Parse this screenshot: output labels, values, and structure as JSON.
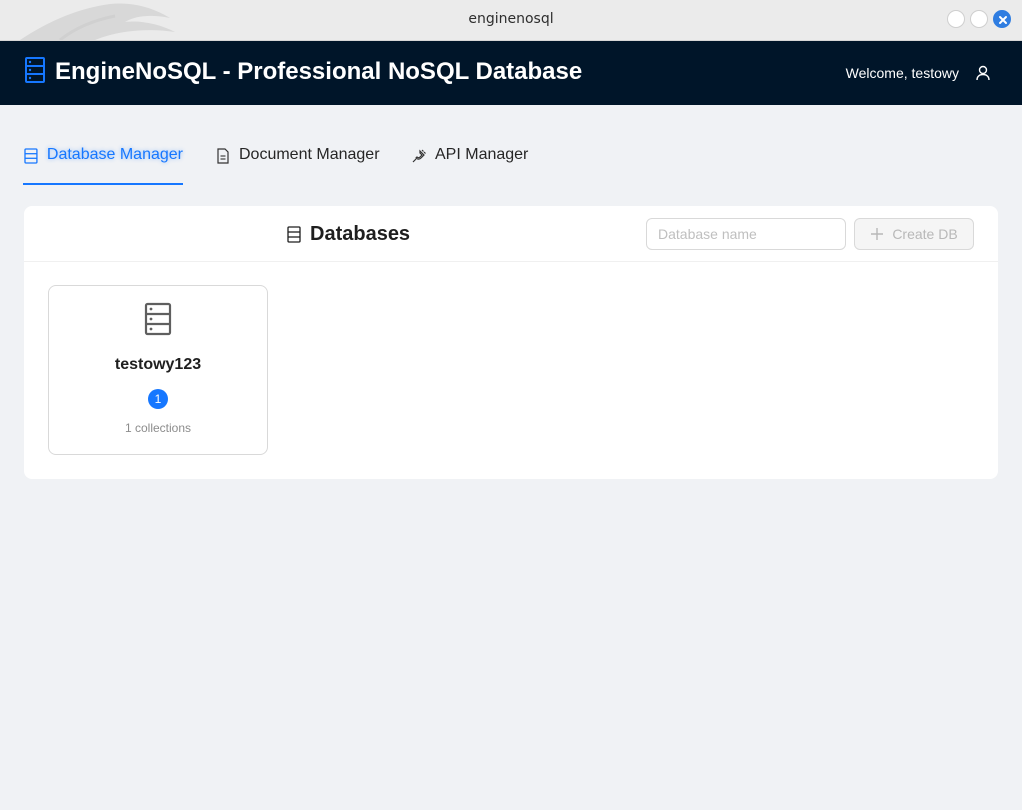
{
  "window": {
    "title": "enginenosql"
  },
  "header": {
    "app_title": "EngineNoSQL - Professional NoSQL Database",
    "welcome_text": "Welcome, testowy",
    "icons": {
      "logo": "database-icon",
      "user": "user-icon"
    }
  },
  "tabs": [
    {
      "label": "Database Manager",
      "icon": "database-icon",
      "active": true
    },
    {
      "label": "Document Manager",
      "icon": "document-icon",
      "active": false
    },
    {
      "label": "API Manager",
      "icon": "api-plug-icon",
      "active": false
    }
  ],
  "databases_panel": {
    "title": "Databases",
    "input_placeholder": "Database name",
    "input_value": "",
    "create_button_label": "Create DB",
    "items": [
      {
        "name": "testowy123",
        "badge": "1",
        "collections_text": "1 collections"
      }
    ]
  },
  "colors": {
    "accent": "#1677ff",
    "header_bg": "#001529",
    "page_bg": "#f0f2f5"
  }
}
